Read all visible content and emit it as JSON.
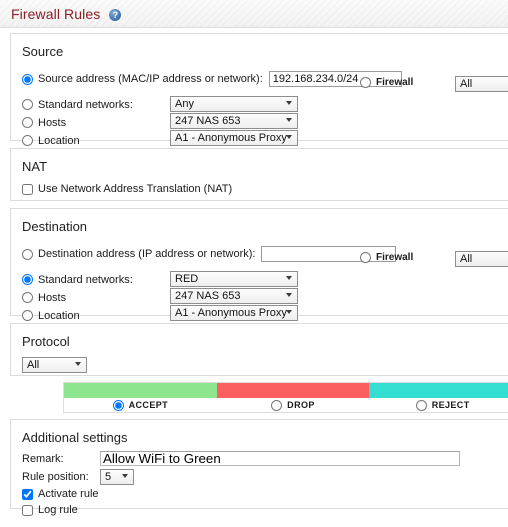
{
  "header": {
    "title": "Firewall Rules",
    "help_icon": "help-circle-icon",
    "help_label": "?"
  },
  "source": {
    "heading": "Source",
    "address_radio_label": "Source address (MAC/IP address or network):",
    "address_value": "192.168.234.0/24",
    "address_placeholder": "",
    "standard_networks_label": "Standard networks:",
    "standard_networks_value": "Any",
    "hosts_label": "Hosts",
    "hosts_value": "247 NAS 653",
    "location_label": "Location",
    "location_value": "A1 - Anonymous Proxy",
    "firewall_label": "Firewall",
    "firewall_value": "All"
  },
  "nat": {
    "heading": "NAT",
    "use_nat_label": "Use Network Address Translation (NAT)"
  },
  "destination": {
    "heading": "Destination",
    "address_radio_label": "Destination address (IP address or network):",
    "address_value": "",
    "address_placeholder": "",
    "standard_networks_label": "Standard networks:",
    "standard_networks_value": "RED",
    "hosts_label": "Hosts",
    "hosts_value": "247 NAS 653",
    "location_label": "Location",
    "location_value": "A1 - Anonymous Proxy",
    "firewall_label": "Firewall",
    "firewall_value": "All"
  },
  "protocol": {
    "heading": "Protocol",
    "value": "All"
  },
  "action": {
    "accept_label": "ACCEPT",
    "accept_color": "#8de68d",
    "drop_label": "DROP",
    "drop_color": "#fc5f5f",
    "reject_label": "REJECT",
    "reject_color": "#34ded0"
  },
  "additional": {
    "heading": "Additional settings",
    "remark_label": "Remark:",
    "remark_value": "Allow WiFi to Green",
    "remark_placeholder": "",
    "rule_position_label": "Rule position:",
    "rule_position_value": "5",
    "activate_rule_label": "Activate rule",
    "log_rule_label": "Log rule"
  }
}
